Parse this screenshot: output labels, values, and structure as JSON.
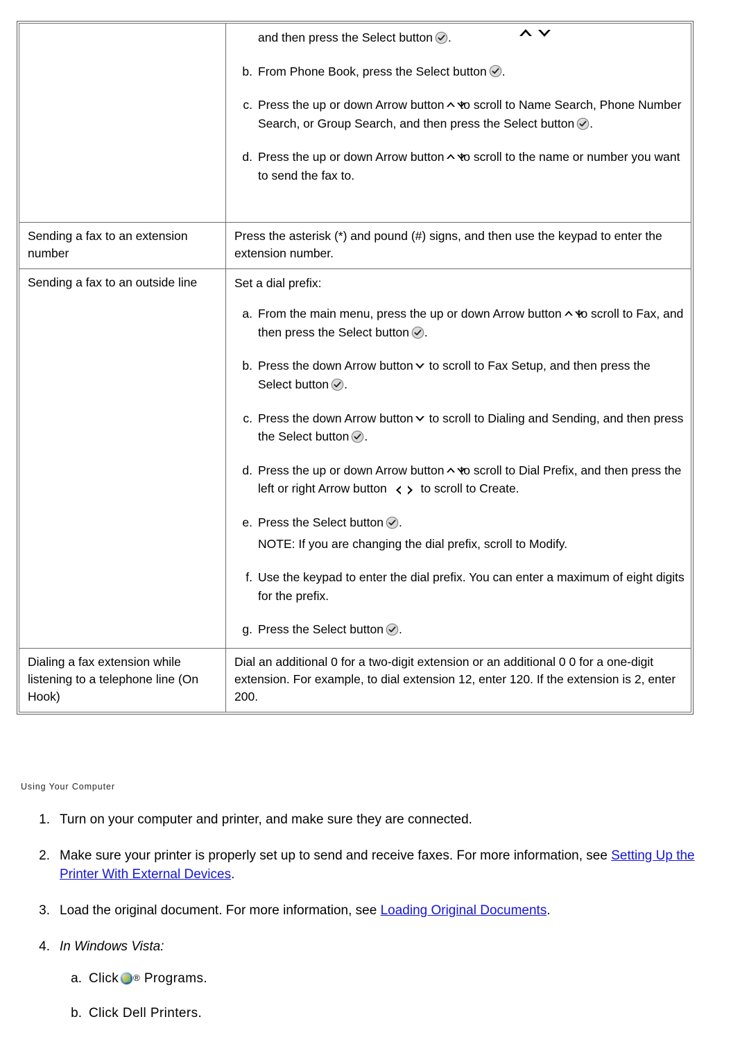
{
  "table": {
    "rows": [
      {
        "id": "phone-book-continued",
        "label": "",
        "type": "continuation",
        "lines": [
          {
            "kind": "cont",
            "text_before": "and then press the Select button",
            "icon": "select-button-icon",
            "text_after": "."
          },
          {
            "kind": "item",
            "marker": "b.",
            "text_before": "From Phone Book, press the Select button",
            "icon": "select-button-icon",
            "text_after": "."
          },
          {
            "kind": "item",
            "marker": "c.",
            "text_before": "Press the up or down Arrow button",
            "icon": "up-down-arrow-icon",
            "text_after": "to scroll to Name Search, Phone Number Search, or Group Search, and then press the Select button",
            "icon2": "select-button-icon",
            "text_end": "."
          },
          {
            "kind": "item",
            "marker": "d.",
            "text_before": "Press the up or down Arrow button",
            "icon": "up-down-arrow-icon",
            "text_after": "to scroll to the name or number you want to send the fax to.",
            "text_end": ""
          }
        ]
      },
      {
        "id": "extension-number",
        "label": "Sending a fax to an extension number",
        "type": "simple",
        "body": "Press the asterisk (*) and pound (#) signs, and then use the keypad to enter the extension number."
      },
      {
        "id": "outside-line",
        "label": "Sending a fax to an outside line",
        "type": "steps",
        "lead": "Set a dial prefix:",
        "steps": [
          {
            "marker": "a.",
            "text_before": "From the main menu, press the up or down Arrow button",
            "icon": "up-down-arrow-icon",
            "text_after": "to scroll to Fax, and then press the Select button",
            "icon2": "select-button-icon",
            "text_end": "."
          },
          {
            "marker": "b.",
            "text_before": "Press the down Arrow button",
            "icon": "down-arrow-icon",
            "text_after": "to scroll to Fax Setup, and then press the Select button",
            "icon2": "select-button-icon",
            "text_end": "."
          },
          {
            "marker": "c.",
            "text_before": "Press the down Arrow button",
            "icon": "down-arrow-icon",
            "text_after": "to scroll to Dialing and Sending, and then press the Select button",
            "icon2": "select-button-icon",
            "text_end": "."
          },
          {
            "marker": "d.",
            "text_before": "Press the up or down Arrow button",
            "icon": "up-down-arrow-icon",
            "text_after": "to scroll to Dial Prefix, and then press the left or right Arrow button",
            "icon2": "left-right-arrow-icon",
            "text_end": "to scroll to Create."
          },
          {
            "marker": "e.",
            "text_before": "Press the Select button",
            "icon": "select-button-icon",
            "text_after": "."
          }
        ],
        "note": "NOTE: If you are changing the dial prefix, scroll to Modify.",
        "steps_after": [
          {
            "marker": "f.",
            "text_before": "Use the keypad to enter the dial prefix. You can enter a maximum of eight digits for the prefix."
          },
          {
            "marker": "g.",
            "text_before": "Press the Select button",
            "icon": "select-button-icon",
            "text_after": "."
          }
        ]
      },
      {
        "id": "on-hook-extension",
        "label": "Dialing a fax extension while listening to a telephone line (On Hook)",
        "type": "simple",
        "body": "Dial an additional 0 for a two-digit extension or an additional 0 0 for a one-digit extension. For example, to dial extension 12, enter 120. If the extension is 2, enter 200."
      }
    ]
  },
  "section": {
    "heading": "Using Your Computer"
  },
  "steps": [
    {
      "marker": "1.",
      "text": "Turn on your computer and printer, and make sure they are connected."
    },
    {
      "marker": "2.",
      "text_before": "Make sure your printer is properly set up to send and receive faxes. For more information, see ",
      "link": "Setting Up the Printer With External Devices",
      "text_after": "."
    },
    {
      "marker": "3.",
      "text_before": "Load the original document. For more information, see ",
      "link": "Loading Original Documents",
      "text_after": "."
    },
    {
      "marker": "4.",
      "italic_text": "In Windows Vista:",
      "substeps": [
        {
          "marker": "a.",
          "text_before": "Click",
          "icon": "windows-vista-orb-icon",
          "reg": "®",
          "text_after": "Programs."
        },
        {
          "marker": "b.",
          "text_before": "Click Dell Printers."
        }
      ]
    }
  ],
  "colors": {
    "link": "#1414dc",
    "text": "#000000",
    "table_border": "#6b6b6b",
    "heading": "#231f20"
  }
}
